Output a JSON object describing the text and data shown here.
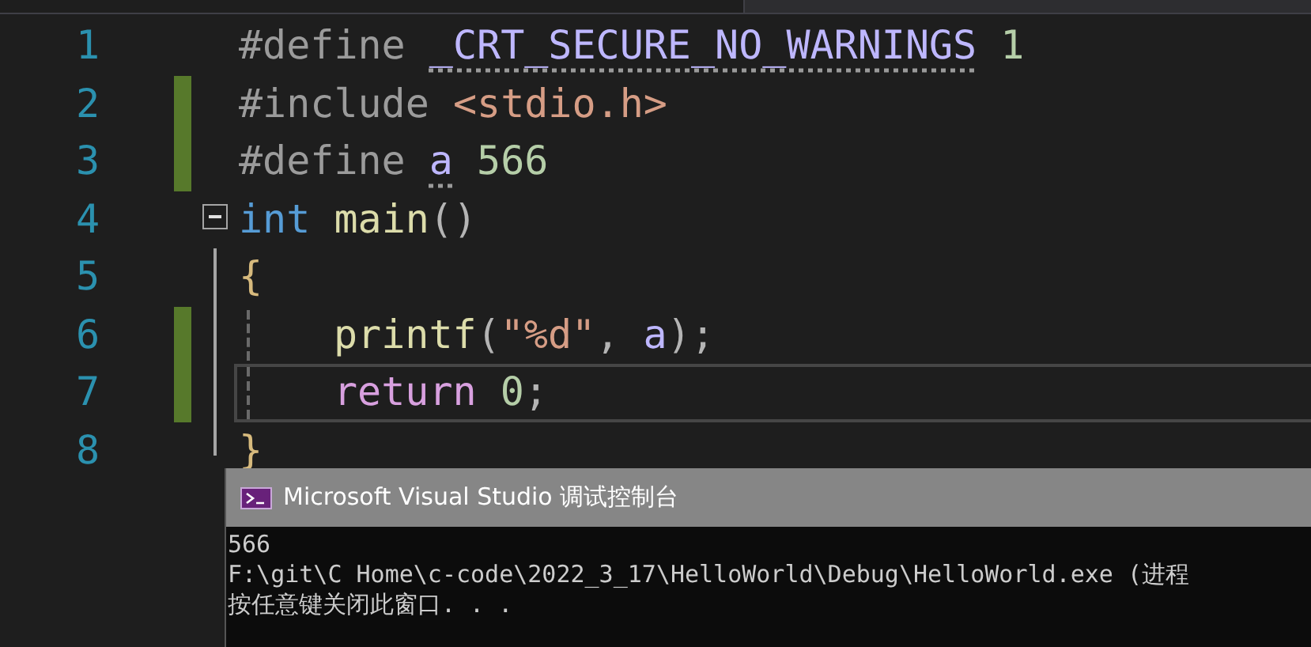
{
  "editor": {
    "lines": [
      {
        "number": "1",
        "changed": false,
        "current": false,
        "kind": "plain",
        "indented": false,
        "tokens": [
          {
            "kind": "pre",
            "text": "#define "
          },
          {
            "kind": "macro",
            "text": "_CRT_SECURE_NO_WARNINGS",
            "hint": true
          },
          {
            "kind": "number",
            "text": " 1"
          }
        ]
      },
      {
        "number": "2",
        "changed": true,
        "current": false,
        "kind": "plain",
        "indented": false,
        "tokens": [
          {
            "kind": "pre",
            "text": "#include "
          },
          {
            "kind": "string",
            "text": "<stdio.h>"
          }
        ]
      },
      {
        "number": "3",
        "changed": true,
        "current": false,
        "kind": "plain",
        "indented": false,
        "tokens": [
          {
            "kind": "pre",
            "text": "#define "
          },
          {
            "kind": "macro",
            "text": "a",
            "hint": true
          },
          {
            "kind": "number",
            "text": " 566"
          }
        ]
      },
      {
        "number": "4",
        "changed": false,
        "current": false,
        "kind": "fold-start",
        "indented": false,
        "tokens": [
          {
            "kind": "keyword",
            "text": "int "
          },
          {
            "kind": "function",
            "text": "main"
          },
          {
            "kind": "punct",
            "text": "()"
          }
        ]
      },
      {
        "number": "5",
        "changed": false,
        "current": false,
        "kind": "fold-body",
        "indented": false,
        "tokens": [
          {
            "kind": "brace",
            "text": "{"
          }
        ]
      },
      {
        "number": "6",
        "changed": true,
        "current": false,
        "kind": "fold-body",
        "indented": true,
        "tokens": [
          {
            "kind": "function",
            "text": "printf"
          },
          {
            "kind": "punct",
            "text": "("
          },
          {
            "kind": "string",
            "text": "\"%d\""
          },
          {
            "kind": "punct",
            "text": ", "
          },
          {
            "kind": "macro",
            "text": "a"
          },
          {
            "kind": "punct",
            "text": ");"
          }
        ]
      },
      {
        "number": "7",
        "changed": true,
        "current": true,
        "kind": "fold-body",
        "indented": true,
        "tokens": [
          {
            "kind": "control",
            "text": "return "
          },
          {
            "kind": "number",
            "text": "0"
          },
          {
            "kind": "punct",
            "text": ";"
          }
        ]
      },
      {
        "number": "8",
        "changed": false,
        "current": false,
        "kind": "fold-end",
        "indented": false,
        "tokens": [
          {
            "kind": "brace",
            "text": "}"
          }
        ]
      }
    ]
  },
  "console": {
    "title": "Microsoft Visual Studio 调试控制台",
    "lines": [
      "566",
      "F:\\git\\C Home\\c-code\\2022_3_17\\HelloWorld\\Debug\\HelloWorld.exe (进程",
      "按任意键关闭此窗口. . ."
    ]
  }
}
